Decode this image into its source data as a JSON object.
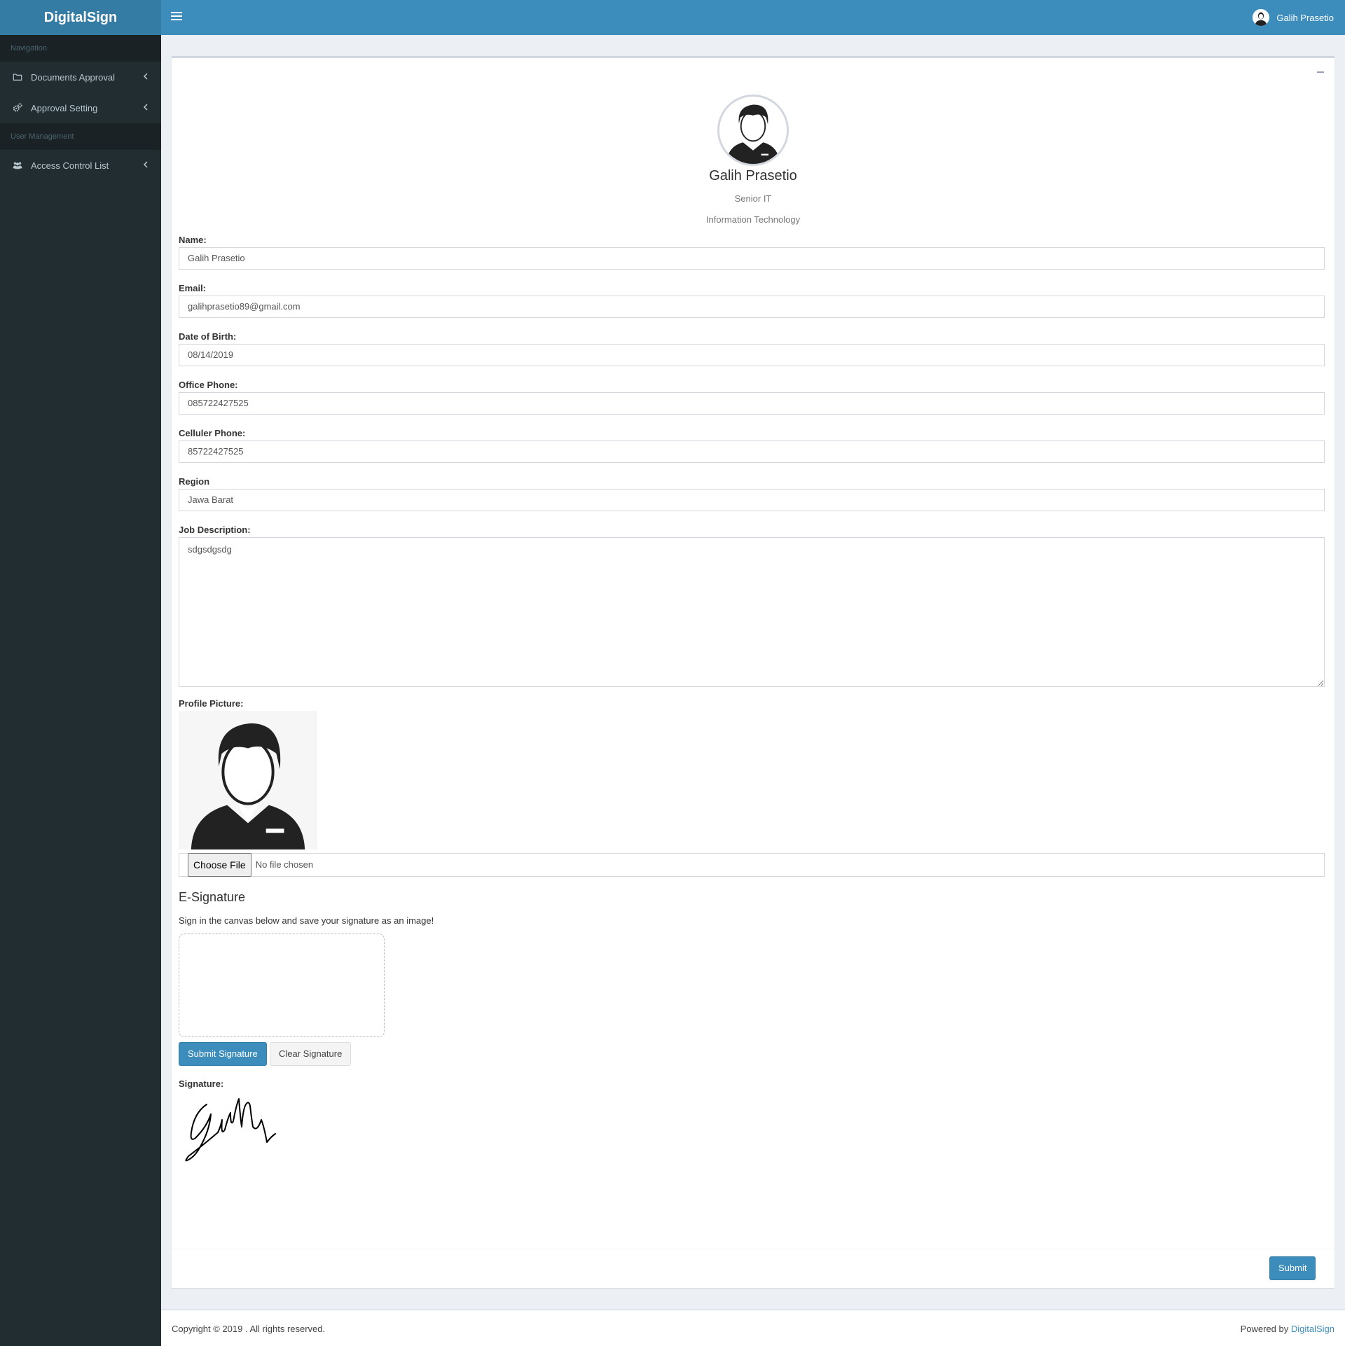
{
  "header": {
    "logo": "DigitalSign",
    "user_name": "Galih Prasetio"
  },
  "sidebar": {
    "sections": [
      {
        "header": "Navigation",
        "items": [
          {
            "label": "Documents Approval",
            "icon": "folder-icon"
          },
          {
            "label": "Approval Setting",
            "icon": "gears-icon"
          }
        ]
      },
      {
        "header": "User Management",
        "items": [
          {
            "label": "Access Control List",
            "icon": "users-icon"
          }
        ]
      }
    ]
  },
  "profile": {
    "name": "Galih Prasetio",
    "position": "Senior IT",
    "department": "Information Technology"
  },
  "form": {
    "name": {
      "label": "Name:",
      "value": "Galih Prasetio"
    },
    "email": {
      "label": "Email:",
      "value": "galihprasetio89@gmail.com"
    },
    "dob": {
      "label": "Date of Birth:",
      "value": "08/14/2019"
    },
    "office_phone": {
      "label": "Office Phone:",
      "value": "085722427525"
    },
    "cell_phone": {
      "label": "Celluler Phone:",
      "value": "85722427525"
    },
    "region": {
      "label": "Region",
      "value": "Jawa Barat"
    },
    "job_description": {
      "label": "Job Description:",
      "value": "sdgsdgsdg"
    },
    "profile_picture": {
      "label": "Profile Picture:",
      "choose_label": "Choose File",
      "file_status": "No file chosen"
    }
  },
  "esignature": {
    "title": "E-Signature",
    "description": "Sign in the canvas below and save your signature as an image!",
    "submit_label": "Submit Signature",
    "clear_label": "Clear Signature",
    "signature_label": "Signature:"
  },
  "actions": {
    "submit_label": "Submit"
  },
  "footer": {
    "copyright": "Copyright © 2019 . All rights reserved.",
    "powered_prefix": "Powered by",
    "powered_link": "DigitalSign"
  },
  "colors": {
    "brand": "#3c8dbc",
    "brand_dark": "#357ca5",
    "sidebar_bg": "#222d32",
    "sidebar_header_bg": "#1a2226"
  }
}
